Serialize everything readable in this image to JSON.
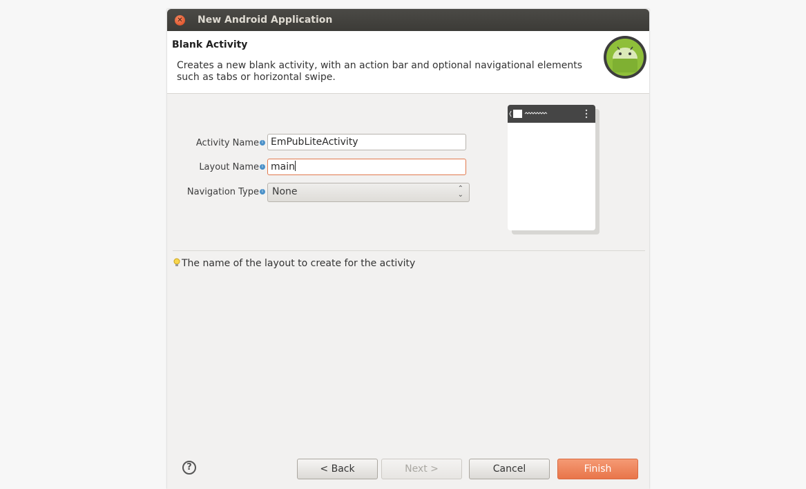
{
  "window": {
    "title": "New Android Application"
  },
  "header": {
    "title": "Blank Activity",
    "description": "Creates a new blank activity, with an action bar and optional navigational elements such as tabs or horizontal swipe."
  },
  "form": {
    "activity_name_label": "Activity Name",
    "activity_name_value": "EmPubLiteActivity",
    "layout_name_label": "Layout Name",
    "layout_name_value": "main",
    "navigation_type_label": "Navigation Type",
    "navigation_type_value": "None"
  },
  "hint": "The name of the layout to create for the activity",
  "footer": {
    "help_label": "?",
    "back_label": "< Back",
    "next_label": "Next >",
    "cancel_label": "Cancel",
    "finish_label": "Finish"
  },
  "colors": {
    "accent": "#e8754a",
    "titlebar": "#3c3b37",
    "android_green": "#8fbf3a"
  },
  "icons": [
    "close-icon",
    "info-icon",
    "lightbulb-icon",
    "help-icon",
    "android-logo",
    "overflow-menu-icon"
  ]
}
